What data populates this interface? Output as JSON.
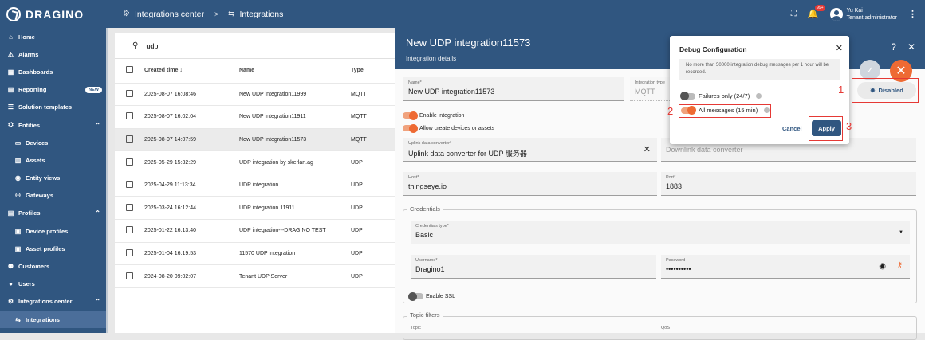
{
  "topbar": {
    "logo_text": "DRAGINO",
    "crumb1": "Integrations center",
    "crumb2": "Integrations",
    "notif_badge": "99+",
    "user_name": "Yu Kai",
    "user_role": "Tenant administrator"
  },
  "sidebar": {
    "items": [
      {
        "label": "Home",
        "icon": "⌂"
      },
      {
        "label": "Alarms",
        "icon": "⚠"
      },
      {
        "label": "Dashboards",
        "icon": "▦"
      },
      {
        "label": "Reporting",
        "icon": "▤",
        "badge": "NEW"
      },
      {
        "label": "Solution templates",
        "icon": "☰"
      },
      {
        "label": "Entities",
        "icon": "⛭"
      },
      {
        "label": "Devices",
        "icon": "▭"
      },
      {
        "label": "Assets",
        "icon": "▥"
      },
      {
        "label": "Entity views",
        "icon": "◉"
      },
      {
        "label": "Gateways",
        "icon": "⚇"
      },
      {
        "label": "Profiles",
        "icon": "▤"
      },
      {
        "label": "Device profiles",
        "icon": "▣"
      },
      {
        "label": "Asset profiles",
        "icon": "▣"
      },
      {
        "label": "Customers",
        "icon": "⚉"
      },
      {
        "label": "Users",
        "icon": "●"
      },
      {
        "label": "Integrations center",
        "icon": "⚙"
      },
      {
        "label": "Integrations",
        "icon": "⇆"
      }
    ]
  },
  "list": {
    "search_value": "udp",
    "headers": {
      "time": "Created time ↓",
      "name": "Name",
      "type": "Type"
    },
    "rows": [
      {
        "time": "2025-08-07 16:08:46",
        "name": "New UDP integration11999",
        "type": "MQTT"
      },
      {
        "time": "2025-08-07 16:02:04",
        "name": "New UDP integration11911",
        "type": "MQTT"
      },
      {
        "time": "2025-08-07 14:07:59",
        "name": "New UDP integration11573",
        "type": "MQTT"
      },
      {
        "time": "2025-05-29 15:32:29",
        "name": "UDP integration by skerlan.ag",
        "type": "UDP"
      },
      {
        "time": "2025-04-29 11:13:34",
        "name": "UDP integration",
        "type": "UDP"
      },
      {
        "time": "2025-03-24 16:12:44",
        "name": "UDP integration 11911",
        "type": "UDP"
      },
      {
        "time": "2025-01-22 16:13:40",
        "name": "UDP integration---DRAGINO TEST",
        "type": "UDP"
      },
      {
        "time": "2025-01-04 16:19:53",
        "name": "11570 UDP integration",
        "type": "UDP"
      },
      {
        "time": "2024-08-20 09:02:07",
        "name": "Tenant UDP Server",
        "type": "UDP"
      }
    ]
  },
  "panel": {
    "title": "New UDP integration11573",
    "subtitle": "Integration details",
    "name_label": "Name*",
    "name_value": "New UDP integration11573",
    "type_label": "Integration type",
    "type_value": "MQTT",
    "enable_label": "Enable integration",
    "allow_label": "Allow create devices or assets",
    "uplink_label": "Uplink data converter*",
    "uplink_value": "Uplink data converter for UDP 服务器",
    "downlink_value": "Downlink data converter",
    "host_label": "Host*",
    "host_value": "thingseye.io",
    "port_label": "Port*",
    "port_value": "1883",
    "credentials_title": "Credentials",
    "cred_type_label": "Credentials type*",
    "cred_type_value": "Basic",
    "username_label": "Username*",
    "username_value": "Dragino1",
    "password_label": "Password",
    "password_value": "••••••••••",
    "ssl_label": "Enable SSL",
    "topic_title": "Topic filters",
    "topic_label": "Topic",
    "qos_label": "QoS",
    "disabled_label": "Disabled"
  },
  "dialog": {
    "title": "Debug Configuration",
    "info": "No more than 50000 integration debug messages per 1 hour will be recorded.",
    "opt1": "Failures only (24/7)",
    "opt2": "All messages (15 min)",
    "cancel": "Cancel",
    "apply": "Apply"
  },
  "annotations": {
    "n1": "1",
    "n2": "2",
    "n3": "3"
  },
  "colors": {
    "primary": "#305680",
    "accent": "#ee6a33",
    "marker": "#e53935"
  }
}
